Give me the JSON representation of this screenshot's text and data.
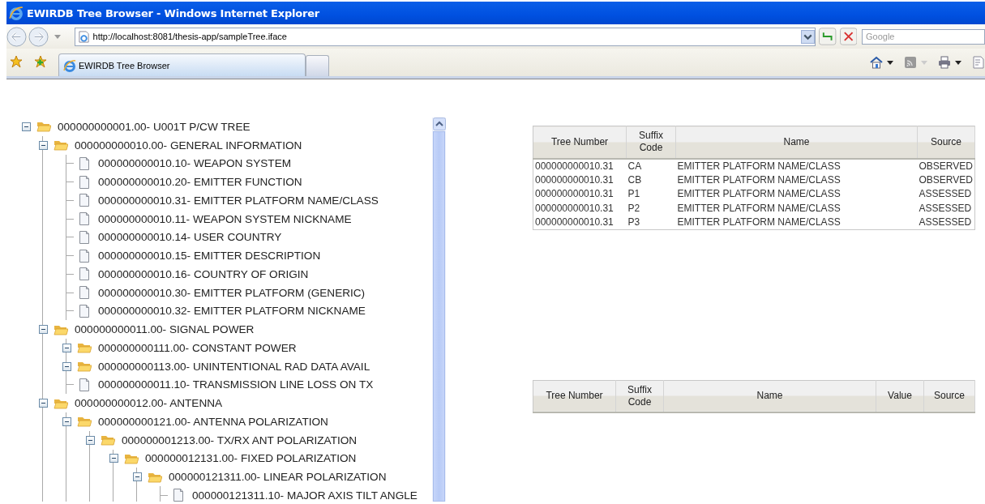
{
  "window": {
    "title": "EWIRDB Tree Browser - Windows Internet Explorer"
  },
  "address": {
    "url": "http://localhost:8081/thesis-app/sampleTree.iface"
  },
  "search": {
    "placeholder": "Google"
  },
  "tabs": [
    {
      "label": "EWIRDB Tree Browser",
      "selected": true
    }
  ],
  "tree": [
    {
      "kind": "folder",
      "label": "000000000001.00- U001T P/CW TREE",
      "expanded": true,
      "children": [
        {
          "kind": "folder",
          "label": "000000000010.00- GENERAL INFORMATION",
          "expanded": true,
          "children": [
            {
              "kind": "leaf",
              "label": "000000000010.10- WEAPON SYSTEM"
            },
            {
              "kind": "leaf",
              "label": "000000000010.20- EMITTER FUNCTION"
            },
            {
              "kind": "leaf",
              "label": "000000000010.31- EMITTER PLATFORM NAME/CLASS"
            },
            {
              "kind": "leaf",
              "label": "000000000010.11- WEAPON SYSTEM NICKNAME"
            },
            {
              "kind": "leaf",
              "label": "000000000010.14- USER COUNTRY"
            },
            {
              "kind": "leaf",
              "label": "000000000010.15- EMITTER DESCRIPTION"
            },
            {
              "kind": "leaf",
              "label": "000000000010.16- COUNTRY OF ORIGIN"
            },
            {
              "kind": "leaf",
              "label": "000000000010.30- EMITTER PLATFORM (GENERIC)"
            },
            {
              "kind": "leaf",
              "label": "000000000010.32- EMITTER PLATFORM NICKNAME"
            }
          ]
        },
        {
          "kind": "folder",
          "label": "000000000011.00- SIGNAL POWER",
          "expanded": true,
          "children": [
            {
              "kind": "folder",
              "label": "000000000111.00- CONSTANT POWER",
              "expanded": true
            },
            {
              "kind": "folder",
              "label": "000000000113.00- UNINTENTIONAL RAD DATA AVAIL",
              "expanded": true
            },
            {
              "kind": "leaf",
              "label": "000000000011.10- TRANSMISSION LINE LOSS ON TX"
            }
          ]
        },
        {
          "kind": "folder",
          "label": "000000000012.00- ANTENNA",
          "expanded": true,
          "children": [
            {
              "kind": "folder",
              "label": "000000000121.00- ANTENNA POLARIZATION",
              "expanded": true,
              "children": [
                {
                  "kind": "folder",
                  "label": "000000001213.00- TX/RX ANT POLARIZATION",
                  "expanded": true,
                  "children": [
                    {
                      "kind": "folder",
                      "label": "000000012131.00- FIXED POLARIZATION",
                      "expanded": true,
                      "children": [
                        {
                          "kind": "folder",
                          "label": "000000121311.00- LINEAR POLARIZATION",
                          "expanded": true,
                          "children": [
                            {
                              "kind": "leaf",
                              "label": "000000121311.10- MAJOR AXIS TILT ANGLE"
                            }
                          ]
                        }
                      ]
                    }
                  ]
                }
              ]
            }
          ]
        }
      ]
    }
  ],
  "tables": [
    {
      "columns": [
        "Tree Number",
        "Suffix Code",
        "Name",
        "Source"
      ],
      "rows": [
        [
          "000000000010.31",
          "CA",
          "EMITTER PLATFORM NAME/CLASS",
          "OBSERVED"
        ],
        [
          "000000000010.31",
          "CB",
          "EMITTER PLATFORM NAME/CLASS",
          "OBSERVED"
        ],
        [
          "000000000010.31",
          "P1",
          "EMITTER PLATFORM NAME/CLASS",
          "ASSESSED"
        ],
        [
          "000000000010.31",
          "P2",
          "EMITTER PLATFORM NAME/CLASS",
          "ASSESSED"
        ],
        [
          "000000000010.31",
          "P3",
          "EMITTER PLATFORM NAME/CLASS",
          "ASSESSED"
        ]
      ]
    },
    {
      "columns": [
        "Tree Number",
        "Suffix Code",
        "Name",
        "Value",
        "Source"
      ]
    }
  ]
}
